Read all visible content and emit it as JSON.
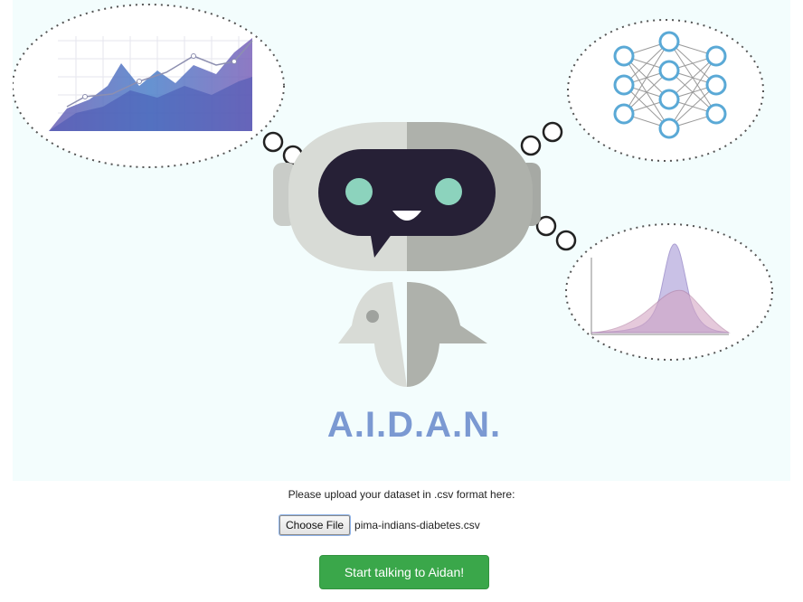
{
  "brand": {
    "name": "A.I.D.A.N."
  },
  "upload": {
    "prompt": "Please upload your dataset in .csv format here:",
    "choose_label": "Choose File",
    "file_name": "pima-indians-diabetes.csv"
  },
  "actions": {
    "start_label": "Start talking to Aidan!"
  },
  "colors": {
    "hero_bg": "#f3fdfd",
    "brand": "#7b99d2",
    "start_button": "#3aa74a",
    "robot_visor": "#262036",
    "robot_eyes": "#8cd3bd"
  },
  "icons": [
    "thought-bubble-chart-icon",
    "thought-bubble-neural-net-icon",
    "thought-bubble-distribution-icon",
    "robot-mascot-icon"
  ]
}
